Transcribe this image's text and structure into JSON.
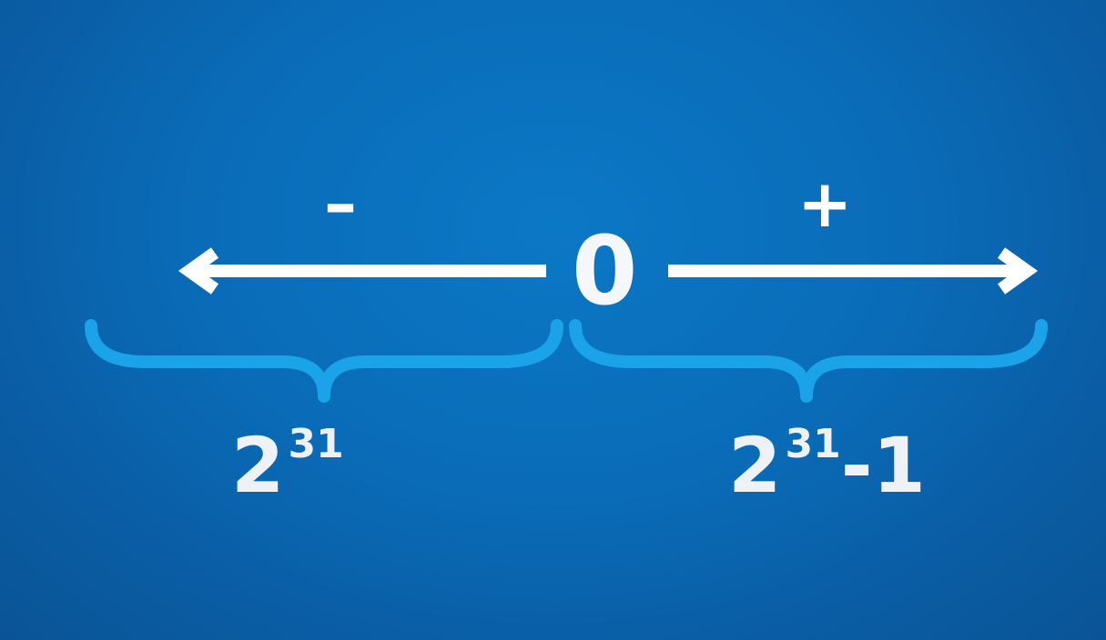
{
  "diagram": {
    "zero_label": "0",
    "negative_sign": "–",
    "positive_sign": "+",
    "negative_count": {
      "base": "2",
      "exponent": "31"
    },
    "positive_count": {
      "base": "2",
      "exponent": "31",
      "suffix": "-1"
    }
  },
  "colors": {
    "background": "#0a6cb8",
    "arrow": "#ffffff",
    "brace": "#1aa3e8",
    "text": "#ffffff"
  }
}
